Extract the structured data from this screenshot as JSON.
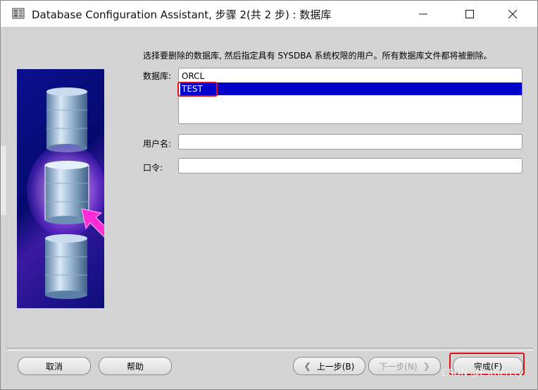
{
  "window": {
    "title": "Database Configuration Assistant, 步骤 2(共 2 步) : 数据库",
    "minimize_icon": "minimize-icon",
    "maximize_icon": "maximize-icon",
    "close_icon": "close-icon"
  },
  "form": {
    "instruction": "选择要删除的数据库, 然后指定具有 SYSDBA 系统权限的用户。所有数据库文件都将被删除。",
    "database_label": "数据库:",
    "databases": [
      {
        "name": "ORCL",
        "selected": false
      },
      {
        "name": "TEST",
        "selected": true
      }
    ],
    "username_label": "用户名:",
    "username_value": "",
    "password_label": "口令:",
    "password_value": ""
  },
  "buttons": {
    "cancel": "取消",
    "help": "帮助",
    "back": "上一步(B)",
    "next": "下一步(N)",
    "finish": "完成(F)"
  },
  "watermark": "CSDN @EstherLty",
  "colors": {
    "selection": "#0000cc",
    "highlight_box": "#e01010",
    "graphic_bg": "#0a0f8f",
    "arrow": "#ff2bd6"
  }
}
